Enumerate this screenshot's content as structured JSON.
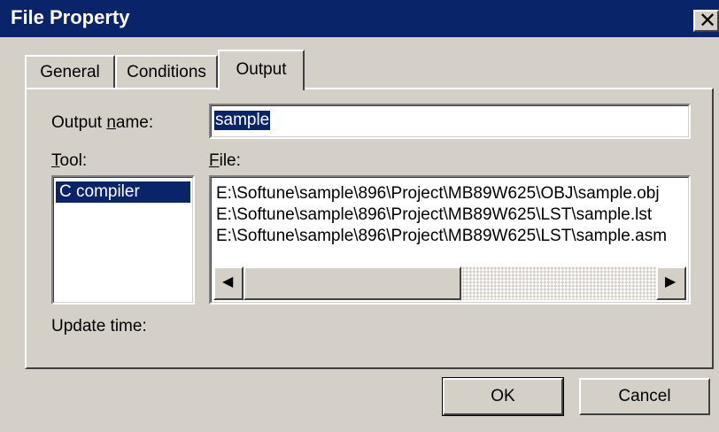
{
  "window": {
    "title": "File Property",
    "close_glyph": "✕"
  },
  "tabs": [
    {
      "label": "General",
      "active": false
    },
    {
      "label": "Conditions",
      "active": false
    },
    {
      "label": "Output",
      "active": true
    }
  ],
  "output_name": {
    "label_pre": "Output ",
    "label_mnemonic": "n",
    "label_post": "ame:",
    "value": "sample"
  },
  "tool": {
    "label_mnemonic": "T",
    "label_post": "ool:",
    "items": [
      "C compiler"
    ]
  },
  "file": {
    "label_mnemonic": "F",
    "label_post": "ile:",
    "items": [
      "E:\\Softune\\sample\\896\\Project\\MB89W625\\OBJ\\sample.obj",
      "E:\\Softune\\sample\\896\\Project\\MB89W625\\LST\\sample.lst",
      "E:\\Softune\\sample\\896\\Project\\MB89W625\\LST\\sample.asm"
    ],
    "scroll_left_glyph": "◀",
    "scroll_right_glyph": "▶"
  },
  "update_time": {
    "label": "Update time:"
  },
  "buttons": {
    "ok": "OK",
    "cancel": "Cancel"
  },
  "colors": {
    "titlebar": "#0a246a",
    "face": "#d4d0c8",
    "selection": "#0a246a"
  }
}
